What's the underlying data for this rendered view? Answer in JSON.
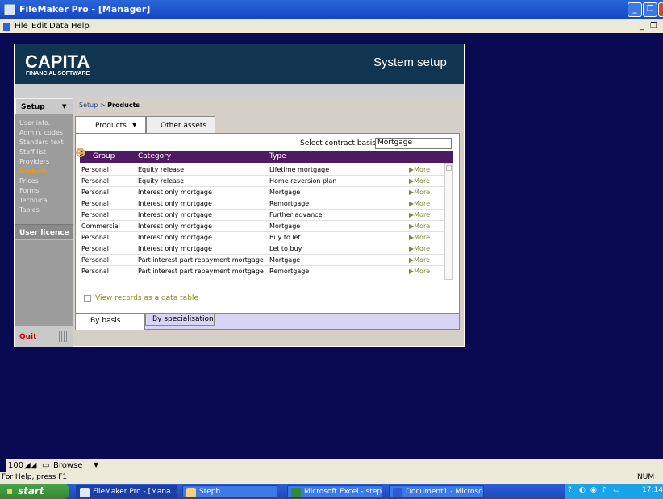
{
  "window": {
    "title": "FileMaker Pro - [Manager]"
  },
  "menu": {
    "items": [
      "File",
      "Edit",
      "Data",
      "Help"
    ]
  },
  "app": {
    "brand": "CAPITA",
    "brand_sub": "FINANCIAL SOFTWARE",
    "header_title": "System setup",
    "breadcrumb_root": "Setup",
    "breadcrumb_sep": ">",
    "breadcrumb_current": "Products"
  },
  "sidebar": {
    "section": "Setup",
    "items": [
      "User info.",
      "Admin. codes",
      "Standard text",
      "Staff list",
      "Providers",
      "Products",
      "Prices",
      "Forms",
      "Technical",
      "Tables"
    ],
    "active_item": "Products",
    "user_licence": "User licence",
    "quit": "Quit"
  },
  "tabs": {
    "products": "Products",
    "other_assets": "Other assets"
  },
  "contract": {
    "label": "Select contract basis",
    "value": "Mortgage"
  },
  "table": {
    "headers": [
      "Group",
      "Category",
      "Type"
    ],
    "more_label": "More",
    "rows": [
      [
        "Personal",
        "Equity release",
        "Lifetime mortgage"
      ],
      [
        "Personal",
        "Equity release",
        "Home reversion plan"
      ],
      [
        "Personal",
        "Interest only mortgage",
        "Mortgage"
      ],
      [
        "Personal",
        "Interest only mortgage",
        "Remortgage"
      ],
      [
        "Personal",
        "Interest only mortgage",
        "Further advance"
      ],
      [
        "Commercial",
        "Interest only mortgage",
        "Mortgage"
      ],
      [
        "Personal",
        "Interest only mortgage",
        "Buy to let"
      ],
      [
        "Personal",
        "Interest only mortgage",
        "Let to buy"
      ],
      [
        "Personal",
        "Part interest part repayment mortgage",
        "Mortgage"
      ],
      [
        "Personal",
        "Part interest part repayment mortgage",
        "Remortgage"
      ]
    ]
  },
  "view_records": "View records as a data table",
  "bottom_tabs": {
    "by_basis": "By basis",
    "by_specialisation": "By specialisation"
  },
  "zoom": {
    "level": "100",
    "mode": "Browse"
  },
  "status": {
    "help": "For Help, press F1",
    "num": "NUM"
  },
  "taskbar": {
    "start": "start",
    "tasks": [
      "FileMaker Pro - [Mana...",
      "Steph",
      "Microsoft Excel - step...",
      "Document1 - Microsof..."
    ],
    "clock": "17:14"
  }
}
